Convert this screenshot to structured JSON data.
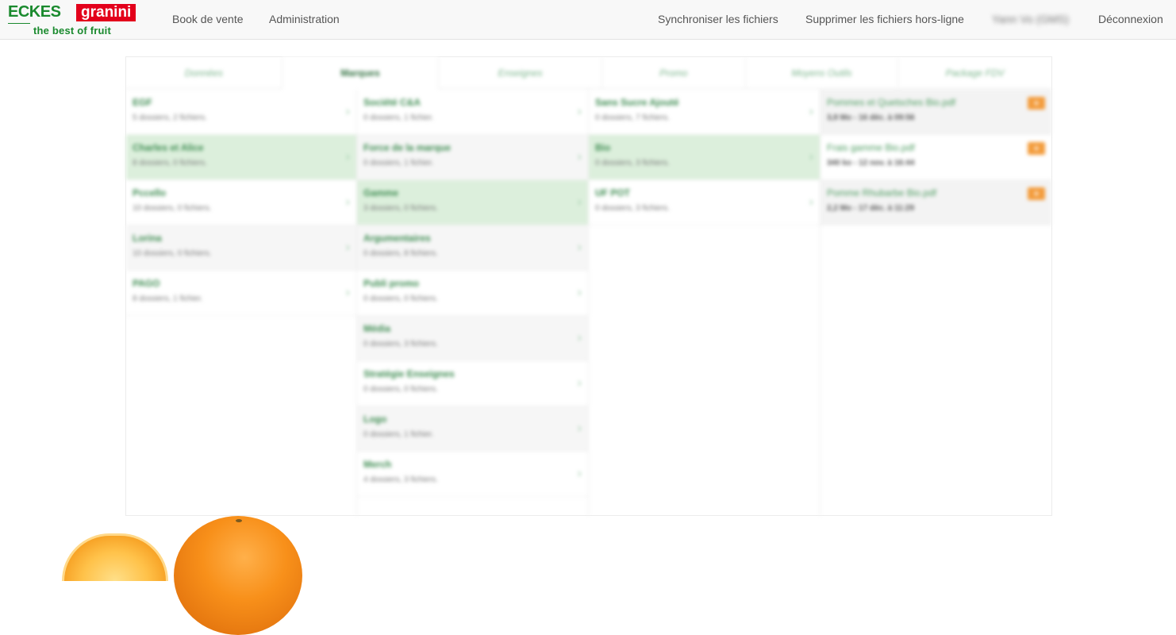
{
  "brand": {
    "name_part1": "ECKES",
    "name_part2": "granini",
    "tagline": "the best of fruit"
  },
  "nav": {
    "book": "Book de vente",
    "admin": "Administration",
    "sync": "Synchroniser les fichiers",
    "delete_offline": "Supprimer les fichiers hors-ligne",
    "user": "Yann Vo (GMS)",
    "logout": "Déconnexion"
  },
  "tabs": [
    "Données",
    "Marques",
    "Enseignes",
    "Promo",
    "Moyens Outils",
    "Package FDV"
  ],
  "active_tab": "Marques",
  "col1": [
    {
      "name": "EGF",
      "meta": "5 dossiers, 2 fichiers."
    },
    {
      "name": "Charles et Alice",
      "meta": "8 dossiers, 0 fichiers."
    },
    {
      "name": "Pccello",
      "meta": "10 dossiers, 0 fichiers."
    },
    {
      "name": "Lorina",
      "meta": "10 dossiers, 0 fichiers."
    },
    {
      "name": "PAGO",
      "meta": "8 dossiers, 1 fichier."
    }
  ],
  "col2": [
    {
      "name": "Société C&A",
      "meta": "0 dossiers, 1 fichier."
    },
    {
      "name": "Force de la marque",
      "meta": "0 dossiers, 1 fichier."
    },
    {
      "name": "Gamme",
      "meta": "3 dossiers, 0 fichiers."
    },
    {
      "name": "Argumentaires",
      "meta": "0 dossiers, 8 fichiers."
    },
    {
      "name": "Publi promo",
      "meta": "0 dossiers, 0 fichiers."
    },
    {
      "name": "Média",
      "meta": "0 dossiers, 3 fichiers."
    },
    {
      "name": "Stratégie Enseignes",
      "meta": "0 dossiers, 0 fichiers."
    },
    {
      "name": "Logo",
      "meta": "0 dossiers, 1 fichier."
    },
    {
      "name": "Merch",
      "meta": "4 dossiers, 3 fichiers."
    }
  ],
  "col3": [
    {
      "name": "Sans Sucre Ajouté",
      "meta": "0 dossiers, 7 fichiers."
    },
    {
      "name": "Bio",
      "meta": "0 dossiers, 3 fichiers."
    },
    {
      "name": "UF POT",
      "meta": "0 dossiers, 3 fichiers."
    }
  ],
  "files": [
    {
      "name": "Pommes et Quetsches Bio.pdf",
      "meta": "3,8 Mo - 16 déc. à 09:56",
      "badge": "+"
    },
    {
      "name": "Frais gamme Bio.pdf",
      "meta": "340 ko - 12 nov. à 16:44",
      "badge": "+"
    },
    {
      "name": "Pomme Rhubarbe Bio.pdf",
      "meta": "2,2 Mo - 17 déc. à 11:29",
      "badge": "+"
    }
  ],
  "selected": {
    "col1": 1,
    "col2": 2,
    "col3": 1
  },
  "colors": {
    "brand_green": "#1a8a2e",
    "brand_red": "#e3001b",
    "selected_bg": "#dcefdc",
    "badge": "#f39c3c"
  }
}
